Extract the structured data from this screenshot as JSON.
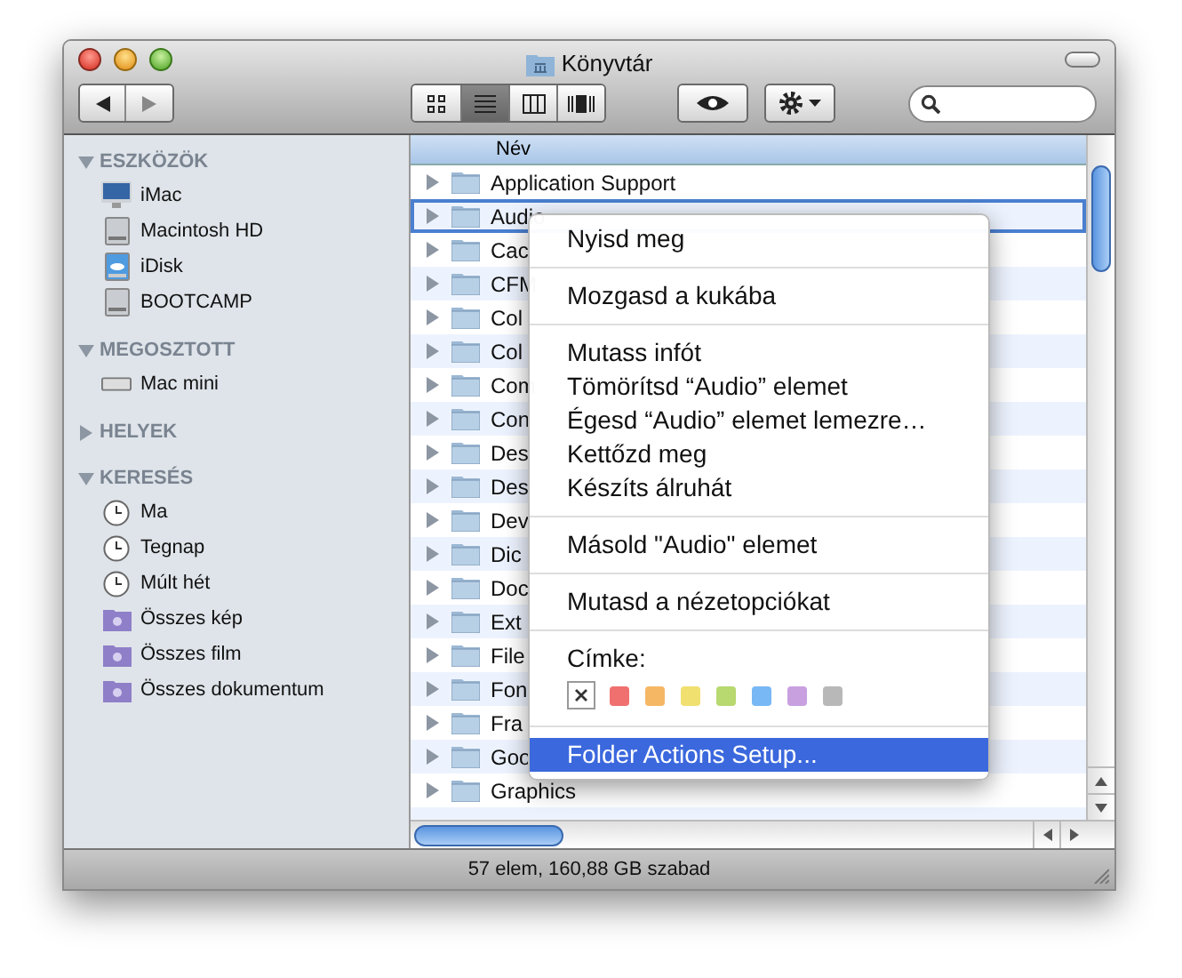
{
  "window": {
    "title": "Könyvtár"
  },
  "toolbar": {
    "view_buttons": [
      {
        "selected": false
      },
      {
        "selected": true
      },
      {
        "selected": false
      },
      {
        "selected": false
      }
    ]
  },
  "sidebar": {
    "sections": [
      {
        "title": "ESZKÖZÖK",
        "expanded": true,
        "items": [
          {
            "label": "iMac",
            "kind": "computer"
          },
          {
            "label": "Macintosh HD",
            "kind": "disk"
          },
          {
            "label": "iDisk",
            "kind": "cloud"
          },
          {
            "label": "BOOTCAMP",
            "kind": "disk"
          }
        ]
      },
      {
        "title": "MEGOSZTOTT",
        "expanded": true,
        "items": [
          {
            "label": "Mac mini",
            "kind": "server"
          }
        ]
      },
      {
        "title": "HELYEK",
        "expanded": false
      },
      {
        "title": "KERESÉS",
        "expanded": true,
        "items": [
          {
            "label": "Ma",
            "kind": "clock"
          },
          {
            "label": "Tegnap",
            "kind": "clock"
          },
          {
            "label": "Múlt hét",
            "kind": "clock"
          },
          {
            "label": "Összes kép",
            "kind": "search"
          },
          {
            "label": "Összes film",
            "kind": "search"
          },
          {
            "label": "Összes dokumentum",
            "kind": "search"
          }
        ]
      }
    ]
  },
  "file_list": {
    "column": "Név",
    "rows": [
      {
        "name": "Application Support",
        "selected": false
      },
      {
        "name": "Audio",
        "selected": true
      },
      {
        "name": "Cac",
        "selected": false
      },
      {
        "name": "CFM",
        "selected": false
      },
      {
        "name": "Col",
        "selected": false
      },
      {
        "name": "Col",
        "selected": false
      },
      {
        "name": "Com",
        "selected": false
      },
      {
        "name": "Con",
        "selected": false
      },
      {
        "name": "Des",
        "selected": false
      },
      {
        "name": "Des",
        "selected": false
      },
      {
        "name": "Dev",
        "selected": false
      },
      {
        "name": "Dic",
        "selected": false
      },
      {
        "name": "Doc",
        "selected": false
      },
      {
        "name": "Ext",
        "selected": false
      },
      {
        "name": "File",
        "selected": false
      },
      {
        "name": "Fon",
        "selected": false
      },
      {
        "name": "Fra",
        "selected": false
      },
      {
        "name": "Goo",
        "selected": false
      },
      {
        "name": "Graphics",
        "selected": false
      }
    ]
  },
  "context_menu": {
    "groups": [
      [
        {
          "label": "Nyisd meg",
          "selected": false
        }
      ],
      [
        {
          "label": "Mozgasd a kukába",
          "selected": false
        }
      ],
      [
        {
          "label": "Mutass infót",
          "selected": false
        },
        {
          "label": "Tömörítsd “Audio” elemet",
          "selected": false
        },
        {
          "label": "Égesd “Audio” elemet lemezre…",
          "selected": false
        },
        {
          "label": "Kettőzd meg",
          "selected": false
        },
        {
          "label": "Készíts álruhát",
          "selected": false
        }
      ],
      [
        {
          "label": "Másold \"Audio\" elemet",
          "selected": false
        }
      ],
      [
        {
          "label": "Mutasd a nézetopciókat",
          "selected": false
        }
      ]
    ],
    "label_title": "Címke:",
    "label_colors": [
      {
        "kind": "none"
      },
      {
        "kind": "color",
        "color": "#f07070"
      },
      {
        "kind": "color",
        "color": "#f5b764"
      },
      {
        "kind": "color",
        "color": "#f0e070"
      },
      {
        "kind": "color",
        "color": "#b8d870"
      },
      {
        "kind": "color",
        "color": "#78b8f5"
      },
      {
        "kind": "color",
        "color": "#c8a0e0"
      },
      {
        "kind": "color",
        "color": "#b8b8b8"
      }
    ],
    "footer_items": [
      {
        "label": "Folder Actions Setup...",
        "selected": true
      }
    ]
  },
  "status_bar": {
    "text": "57 elem, 160,88 GB szabad"
  }
}
